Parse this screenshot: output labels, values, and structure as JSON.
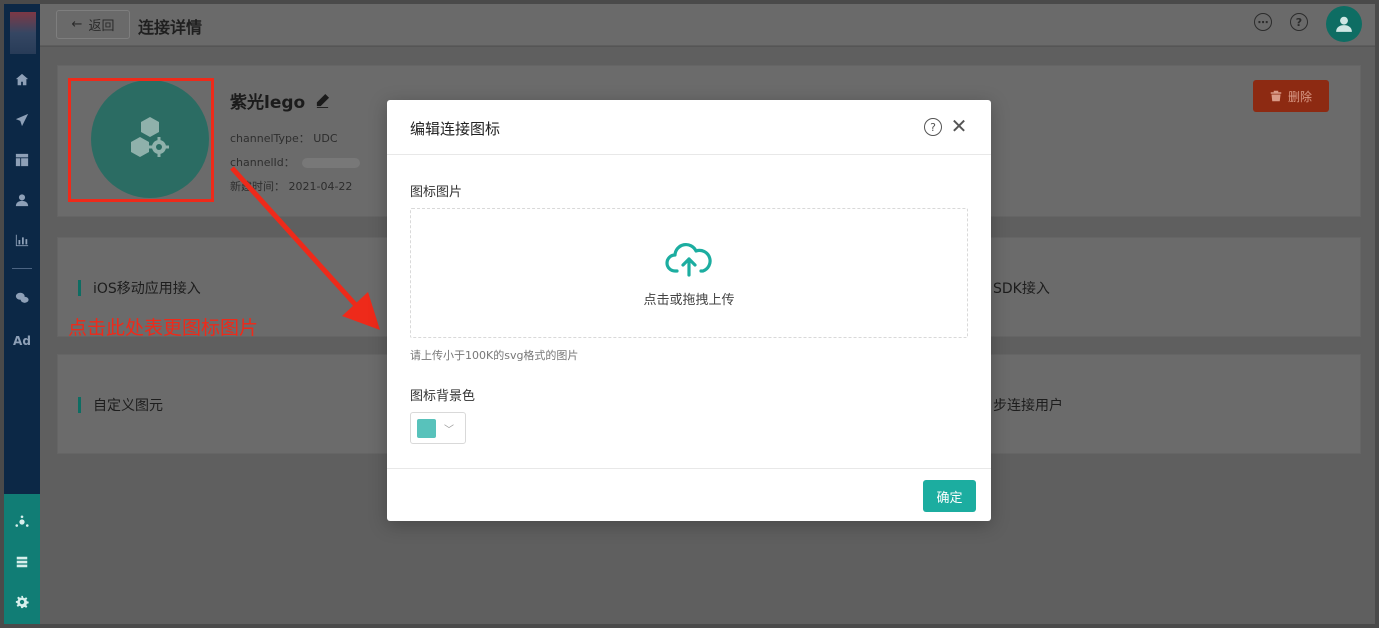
{
  "topbar": {
    "back_label": "返回",
    "page_title": "连接详情"
  },
  "sidebar": {
    "ad_label": "Ad"
  },
  "connection": {
    "name": "紫光lego",
    "channel_type_label": "channelType：",
    "channel_type_value": "UDC",
    "channel_id_label": "channelId：",
    "created_label": "新建时间：",
    "created_value": "2021-04-22",
    "delete_label": "删除"
  },
  "sections": {
    "row1_left": "iOS移动应用接入",
    "row1_right": "SDK接入",
    "row2_left": "自定义图元",
    "row2_right": "步连接用户"
  },
  "annotation": {
    "callout": "点击此处表更图标图片"
  },
  "modal": {
    "title": "编辑连接图标",
    "image_label": "图标图片",
    "upload_text": "点击或拖拽上传",
    "hint": "请上传小于100K的svg格式的图片",
    "bg_color_label": "图标背景色",
    "bg_color": "#58c2bb",
    "confirm_label": "确定"
  },
  "colors": {
    "accent": "#1cada0",
    "danger": "#ee2a1a"
  }
}
